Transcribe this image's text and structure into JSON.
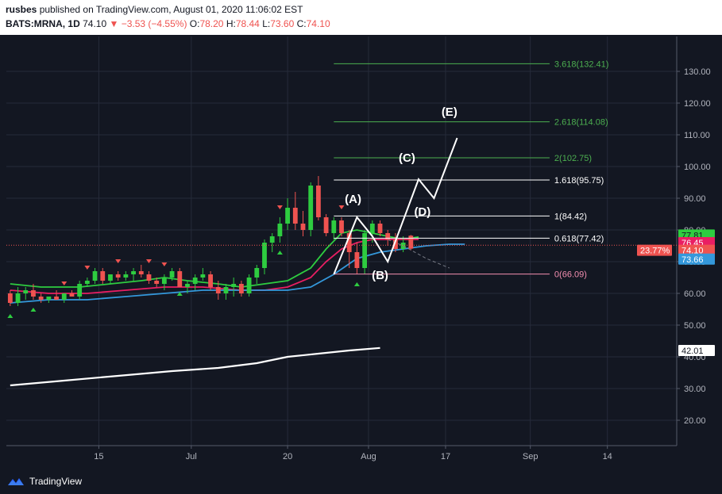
{
  "header": {
    "author": "rusbes",
    "published_text": "published on TradingView.com, August 01, 2020 11:06:02 EST",
    "symbol": "BATS:MRNA, 1D",
    "last": "74.10",
    "change": "▼ −3.53 (−4.55%)",
    "o_label": "O:",
    "o_val": "78.20",
    "h_label": "H:",
    "h_val": "78.44",
    "l_label": "L:",
    "l_val": "73.60",
    "c_label": "C:",
    "c_val": "74.10"
  },
  "footer": {
    "brand": "TradingView"
  },
  "chart_data": {
    "type": "candlestick",
    "ylim": [
      12,
      141
    ],
    "y_ticks": [
      20,
      30,
      40,
      50,
      60,
      70,
      80,
      90,
      100,
      110,
      120,
      130
    ],
    "y_tick_labels": [
      "20.00",
      "30.00",
      "40.00",
      "50.00",
      "60.00",
      "70.00",
      "80.00",
      "90.00",
      "100.00",
      "110.00",
      "120.00",
      "130.00"
    ],
    "x_ticks": [
      {
        "label": "15",
        "idx": 12.5
      },
      {
        "label": "Jul",
        "idx": 24.5
      },
      {
        "label": "20",
        "idx": 37
      },
      {
        "label": "Aug",
        "idx": 47.5
      },
      {
        "label": "17",
        "idx": 57.5
      },
      {
        "label": "Sep",
        "idx": 68.5
      },
      {
        "label": "14",
        "idx": 78.5
      }
    ],
    "x_range": [
      0.5,
      87.5
    ],
    "candles": [
      [
        60,
        61,
        56,
        57
      ],
      [
        57,
        62,
        56,
        60
      ],
      [
        60,
        62,
        58,
        61
      ],
      [
        61,
        63,
        58,
        59
      ],
      [
        59,
        60,
        57,
        58
      ],
      [
        58,
        59,
        57,
        59
      ],
      [
        59,
        61,
        58,
        58
      ],
      [
        58,
        60,
        57,
        60
      ],
      [
        60,
        61,
        59,
        59
      ],
      [
        59,
        64,
        58,
        63
      ],
      [
        63,
        65,
        62,
        64
      ],
      [
        64,
        68,
        63,
        67
      ],
      [
        67,
        68,
        63,
        64
      ],
      [
        64,
        66,
        63,
        66
      ],
      [
        66,
        67,
        64,
        65
      ],
      [
        65,
        67,
        64,
        66
      ],
      [
        66,
        68,
        64,
        67
      ],
      [
        67,
        69,
        65,
        66
      ],
      [
        66,
        67,
        63,
        64
      ],
      [
        64,
        65,
        62,
        63
      ],
      [
        63,
        66,
        61,
        65
      ],
      [
        65,
        68,
        64,
        67
      ],
      [
        67,
        68,
        63,
        62
      ],
      [
        62,
        64,
        60,
        63
      ],
      [
        63,
        66,
        61,
        65
      ],
      [
        65,
        68,
        64,
        66
      ],
      [
        66,
        67,
        61,
        62
      ],
      [
        62,
        64,
        58,
        60
      ],
      [
        60,
        63,
        58,
        62
      ],
      [
        62,
        65,
        59,
        63
      ],
      [
        63,
        64,
        59,
        60
      ],
      [
        60,
        66,
        59,
        65
      ],
      [
        65,
        69,
        63,
        68
      ],
      [
        68,
        77,
        66,
        76
      ],
      [
        76,
        79,
        73,
        78
      ],
      [
        78,
        84,
        76,
        82
      ],
      [
        82,
        90,
        80,
        87
      ],
      [
        87,
        92,
        80,
        82
      ],
      [
        82,
        86,
        78,
        80
      ],
      [
        80,
        95,
        78,
        94
      ],
      [
        94,
        97,
        83,
        84
      ],
      [
        84,
        85,
        78,
        79
      ],
      [
        79,
        84,
        77,
        83
      ],
      [
        83,
        84,
        78,
        79
      ],
      [
        79,
        80,
        68,
        73
      ],
      [
        73,
        76,
        66,
        68
      ],
      [
        68,
        80,
        66,
        79
      ],
      [
        79,
        83,
        76,
        82
      ],
      [
        82,
        83,
        78,
        79
      ],
      [
        79,
        80,
        75,
        77
      ],
      [
        77,
        79,
        73,
        74
      ],
      [
        74,
        78,
        73,
        76
      ],
      [
        78.2,
        78.44,
        73.6,
        74.1
      ]
    ],
    "candle_x_offset": 0,
    "markers_up": [
      1,
      4,
      23,
      36,
      46
    ],
    "markers_down": [
      8,
      11,
      15,
      19,
      21,
      36,
      44
    ],
    "series": [
      {
        "color": "#2ecc40",
        "points": [
          [
            1,
            63
          ],
          [
            5,
            62
          ],
          [
            10,
            62
          ],
          [
            14,
            63
          ],
          [
            18,
            64
          ],
          [
            21,
            65
          ],
          [
            24,
            64
          ],
          [
            28,
            63
          ],
          [
            31,
            62
          ],
          [
            34,
            63
          ],
          [
            37,
            64
          ],
          [
            40,
            68
          ],
          [
            42,
            74
          ],
          [
            44,
            79
          ],
          [
            46,
            80
          ],
          [
            48,
            79
          ],
          [
            50,
            78
          ],
          [
            52,
            77
          ],
          [
            54,
            77.8
          ]
        ]
      },
      {
        "color": "#e91e63",
        "points": [
          [
            1,
            61
          ],
          [
            6,
            60
          ],
          [
            11,
            60
          ],
          [
            16,
            61
          ],
          [
            21,
            62
          ],
          [
            26,
            62
          ],
          [
            31,
            61
          ],
          [
            34,
            61
          ],
          [
            37,
            62
          ],
          [
            40,
            65
          ],
          [
            42,
            70
          ],
          [
            44,
            74
          ],
          [
            46,
            76
          ],
          [
            48,
            77
          ],
          [
            50,
            77
          ],
          [
            52,
            77
          ],
          [
            54,
            77
          ]
        ]
      },
      {
        "color": "#3498db",
        "points": [
          [
            1,
            57
          ],
          [
            6,
            58
          ],
          [
            11,
            58
          ],
          [
            16,
            59
          ],
          [
            21,
            60
          ],
          [
            26,
            61
          ],
          [
            31,
            61
          ],
          [
            34,
            61
          ],
          [
            37,
            61
          ],
          [
            40,
            62
          ],
          [
            43,
            66
          ],
          [
            46,
            71
          ],
          [
            49,
            73
          ],
          [
            52,
            74
          ],
          [
            55,
            75
          ],
          [
            58,
            75.5
          ],
          [
            60,
            75.5
          ]
        ]
      },
      {
        "color": "#ffffff",
        "points": [
          [
            1,
            31
          ],
          [
            8,
            32.5
          ],
          [
            15,
            34
          ],
          [
            22,
            35.5
          ],
          [
            28,
            36.5
          ],
          [
            33,
            38
          ],
          [
            37,
            40
          ],
          [
            41,
            41
          ],
          [
            45,
            42
          ],
          [
            49,
            42.8
          ]
        ]
      }
    ],
    "wave_path": [
      [
        43,
        66
      ],
      [
        46,
        84
      ],
      [
        48,
        78
      ],
      [
        50,
        70
      ],
      [
        54,
        96
      ],
      [
        56,
        90
      ],
      [
        59,
        109
      ]
    ],
    "dash_path": [
      [
        50,
        77
      ],
      [
        52,
        75
      ],
      [
        55,
        71
      ],
      [
        58,
        68
      ]
    ],
    "fib_levels": [
      {
        "label": "3.618(132.41)",
        "value": 132.41,
        "color": "#4caf50",
        "x0": 43,
        "x1": 71
      },
      {
        "label": "2.618(114.08)",
        "value": 114.08,
        "color": "#4caf50",
        "x0": 43,
        "x1": 71
      },
      {
        "label": "2(102.75)",
        "value": 102.75,
        "color": "#4caf50",
        "x0": 43,
        "x1": 71
      },
      {
        "label": "1.618(95.75)",
        "value": 95.75,
        "color": "#ffffff",
        "x0": 43,
        "x1": 71
      },
      {
        "label": "1(84.42)",
        "value": 84.42,
        "color": "#ffffff",
        "x0": 43,
        "x1": 71
      },
      {
        "label": "0.618(77.42)",
        "value": 77.42,
        "color": "#ffffff",
        "x0": 43,
        "x1": 71
      },
      {
        "label": "0(66.09)",
        "value": 66.09,
        "color": "#f48fb1",
        "x0": 43,
        "x1": 71
      }
    ],
    "wave_labels": [
      {
        "text": "(A)",
        "x": 45.5,
        "y": 88.5
      },
      {
        "text": "(B)",
        "x": 49,
        "y": 64.5
      },
      {
        "text": "(C)",
        "x": 52.5,
        "y": 101.5
      },
      {
        "text": "(D)",
        "x": 54.5,
        "y": 84.5
      },
      {
        "text": "(E)",
        "x": 58,
        "y": 116
      }
    ],
    "price_line": {
      "value": 75.2,
      "color": "#ef5350"
    },
    "price_tags": [
      {
        "label": "77.81",
        "value": 78.4,
        "bg": "#2ecc40",
        "fg": "#131722"
      },
      {
        "label": "76.45",
        "value": 76.0,
        "bg": "#e91e63",
        "fg": "#ffffff"
      },
      {
        "label": "74.10",
        "value": 73.6,
        "bg": "#ef5350",
        "fg": "#ffffff"
      },
      {
        "label": "73.66",
        "value": 70.8,
        "bg": "#3498db",
        "fg": "#ffffff"
      },
      {
        "label": "42.01",
        "value": 42.0,
        "bg": "#ffffff",
        "fg": "#131722"
      }
    ],
    "pct_tag": {
      "label": "23.77%",
      "value": 73.6,
      "bg": "#ef5350",
      "fg": "#ffffff"
    },
    "colors": {
      "up": "#26a69a",
      "up_body": "#2ecc40",
      "down": "#ef5350",
      "grid": "#262b3a",
      "axis_text": "#b2b5be"
    }
  }
}
